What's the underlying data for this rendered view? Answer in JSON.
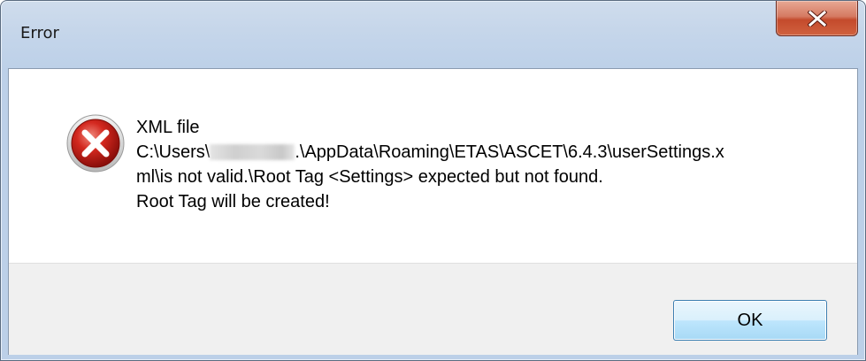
{
  "window": {
    "title": "Error",
    "close_icon": "close-x-icon"
  },
  "dialog": {
    "icon": "error-icon",
    "message_lines": [
      "XML file",
      "C:\\Users\\",
      ".\\AppData\\Roaming\\ETAS\\ASCET\\6.4.3\\userSettings.x",
      "ml\\is not valid.\\Root Tag <Settings> expected but not found.",
      "Root Tag will be created!"
    ],
    "ok_label": "OK"
  },
  "colors": {
    "error_red": "#d3281f",
    "close_button": "#c44a2c",
    "button_border": "#3c7fb1"
  }
}
